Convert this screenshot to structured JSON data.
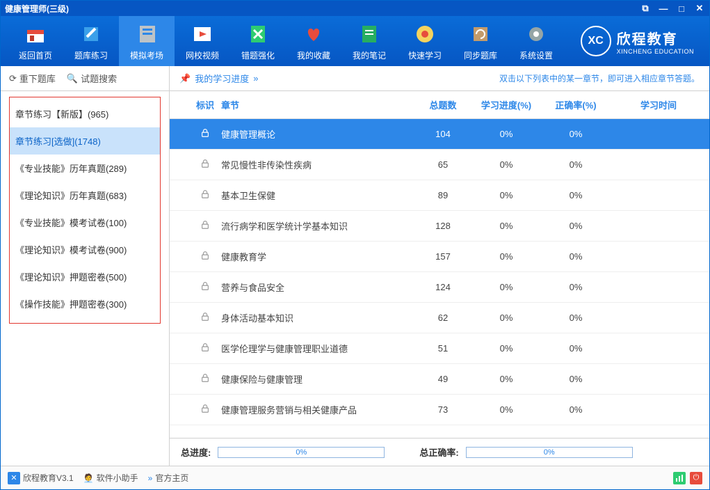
{
  "window": {
    "title": "健康管理师(三级)"
  },
  "toolbar": [
    {
      "name": "home",
      "label": "返回首页",
      "active": false,
      "color": "#e74c3c"
    },
    {
      "name": "practice",
      "label": "题库练习",
      "active": false,
      "color": "#3aa0ea"
    },
    {
      "name": "mock",
      "label": "模拟考场",
      "active": true,
      "color": "#8e9bab"
    },
    {
      "name": "video",
      "label": "网校视频",
      "active": false,
      "color": "#f1c40f"
    },
    {
      "name": "wrong",
      "label": "错题强化",
      "active": false,
      "color": "#2ecc71"
    },
    {
      "name": "fav",
      "label": "我的收藏",
      "active": false,
      "color": "#e74c3c"
    },
    {
      "name": "notes",
      "label": "我的笔记",
      "active": false,
      "color": "#27ae60"
    },
    {
      "name": "fast",
      "label": "快速学习",
      "active": false,
      "color": "#f39c12"
    },
    {
      "name": "sync",
      "label": "同步题库",
      "active": false,
      "color": "#c39b6b"
    },
    {
      "name": "settings",
      "label": "系统设置",
      "active": false,
      "color": "#95a5a6"
    }
  ],
  "brand": {
    "abbr": "XC",
    "name": "欣程教育",
    "en": "XINCHENG EDUCATION"
  },
  "sidebar_top": {
    "redown": "重下题库",
    "search": "试题搜索"
  },
  "sidebar_items": [
    "章节练习【新版】(965)",
    "章节练习[选做](1748)",
    "《专业技能》历年真题(289)",
    "《理论知识》历年真题(683)",
    "《专业技能》模考试卷(100)",
    "《理论知识》模考试卷(900)",
    "《理论知识》押题密卷(500)",
    "《操作技能》押题密卷(300)"
  ],
  "sidebar_selected": 1,
  "breadcrumb": "我的学习进度",
  "hint": "双击以下列表中的某一章节，即可进入相应章节答题。",
  "columns": {
    "mark": "标识",
    "chapter": "章节",
    "total": "总题数",
    "progress": "学习进度(%)",
    "accuracy": "正确率(%)",
    "time": "学习时间"
  },
  "rows": [
    {
      "chapter": "健康管理概论",
      "total": "104",
      "progress": "0%",
      "accuracy": "0%",
      "hl": true
    },
    {
      "chapter": "常见慢性非传染性疾病",
      "total": "65",
      "progress": "0%",
      "accuracy": "0%"
    },
    {
      "chapter": "基本卫生保健",
      "total": "89",
      "progress": "0%",
      "accuracy": "0%"
    },
    {
      "chapter": "流行病学和医学统计学基本知识",
      "total": "128",
      "progress": "0%",
      "accuracy": "0%"
    },
    {
      "chapter": "健康教育学",
      "total": "157",
      "progress": "0%",
      "accuracy": "0%"
    },
    {
      "chapter": "营养与食品安全",
      "total": "124",
      "progress": "0%",
      "accuracy": "0%"
    },
    {
      "chapter": "身体活动基本知识",
      "total": "62",
      "progress": "0%",
      "accuracy": "0%"
    },
    {
      "chapter": "医学伦理学与健康管理职业道德",
      "total": "51",
      "progress": "0%",
      "accuracy": "0%"
    },
    {
      "chapter": "健康保险与健康管理",
      "total": "49",
      "progress": "0%",
      "accuracy": "0%"
    },
    {
      "chapter": "健康管理服务营销与相关健康产品",
      "total": "73",
      "progress": "0%",
      "accuracy": "0%"
    }
  ],
  "summary": {
    "total_label": "总进度:",
    "total_pct": "0%",
    "acc_label": "总正确率:",
    "acc_pct": "0%"
  },
  "status": {
    "app": "欣程教育V3.1",
    "helper": "软件小助手",
    "home": "官方主页"
  }
}
